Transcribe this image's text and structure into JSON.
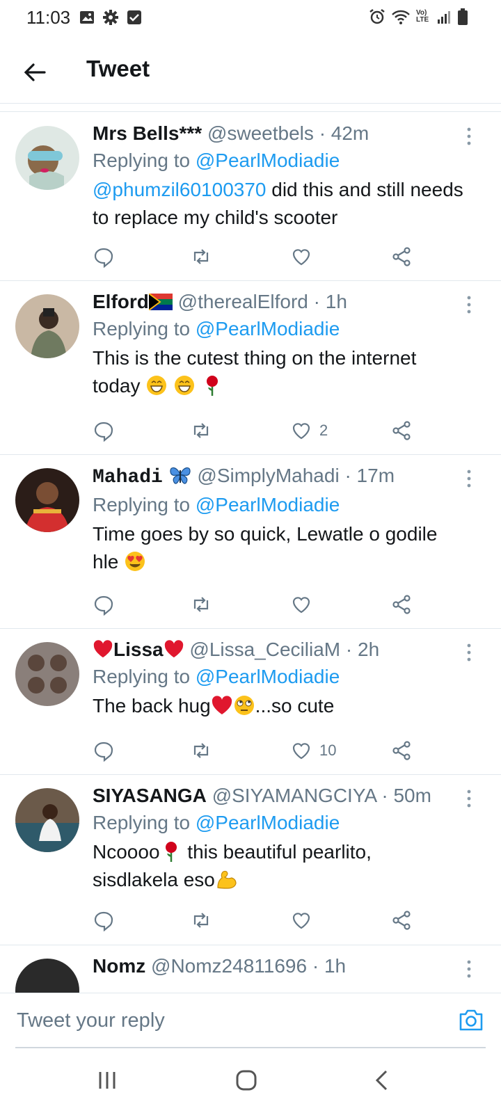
{
  "status_bar": {
    "time": "11:03",
    "left_icons": [
      "image-icon",
      "gear-icon",
      "checkbox-icon"
    ],
    "right_icons": [
      "alarm-icon",
      "wifi-icon",
      "volte-icon",
      "signal-icon",
      "battery-icon"
    ],
    "volte_label": "Vo) LTE"
  },
  "header": {
    "title": "Tweet"
  },
  "tweets": [
    {
      "name": "Mrs Bells***",
      "handle": "@sweetbels",
      "time": "· 42m",
      "replying_prefix": "Replying to",
      "replying_to": "@PearlModiadie",
      "text_mention": "@phumzil60100370",
      "text": " did this and still needs to replace my child's scooter",
      "likes": ""
    },
    {
      "name": "Elford",
      "handle": "@therealElford",
      "time": "· 1h",
      "replying_prefix": "Replying to",
      "replying_to": "@PearlModiadie",
      "text": "This is the cutest thing on the internet today",
      "likes": "2"
    },
    {
      "name": "Mahadi",
      "handle": "@SimplyMahadi",
      "time": "· 17m",
      "replying_prefix": "Replying to",
      "replying_to": "@PearlModiadie",
      "text": "Time goes by so quick, Lewatle o godile hle",
      "likes": ""
    },
    {
      "name": "Lissa",
      "handle": "@Lissa_CeciliaM",
      "time": "· 2h",
      "replying_prefix": "Replying to",
      "replying_to": "@PearlModiadie",
      "text_before": "The back hug",
      "text_after": "...so cute",
      "likes": "10"
    },
    {
      "name": "SIYASANGA",
      "handle": "@SIYAMANGCIYA",
      "time": "· 50m",
      "replying_prefix": "Replying to",
      "replying_to": "@PearlModiadie",
      "text_before": "Ncoooo",
      "text_mid": " this beautiful pearlito,",
      "text_after": "sisdlakela eso",
      "likes": ""
    },
    {
      "name": "Nomz",
      "handle": "@Nomz24811696",
      "time": "· 1h"
    }
  ],
  "reply_bar": {
    "placeholder": "Tweet your reply"
  },
  "colors": {
    "accent": "#1d9bf0",
    "secondary_text": "#657786",
    "divider": "#e1e8ed"
  }
}
